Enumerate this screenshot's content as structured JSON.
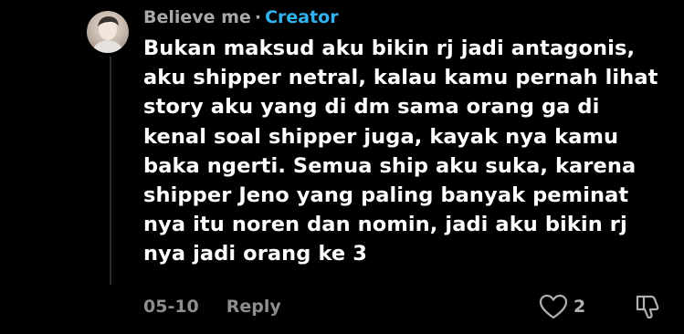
{
  "comment": {
    "username": "Believe me",
    "separator": "·",
    "badge": "Creator",
    "lines": [
      "Bukan maksud aku bikin rj jadi antagonis,",
      "aku shipper netral, kalau kamu pernah lihat",
      "story aku yang di dm sama orang ga di",
      "kenal soal shipper juga, kayak nya kamu",
      "baka ngerti. Semua ship aku suka, karena",
      "shipper Jeno yang paling banyak peminat",
      "nya itu noren dan nomin, jadi aku bikin rj",
      "nya jadi orang ke 3"
    ],
    "date": "05-10",
    "reply_label": "Reply",
    "like_count": "2",
    "like_icon": "heart-outline-icon",
    "dislike_icon": "thumbs-down-icon"
  },
  "colors": {
    "background": "#000000",
    "username": "#a8a8a8",
    "creator_badge": "#30b3f0",
    "text": "#ffffff",
    "meta": "#8e8e8e"
  }
}
